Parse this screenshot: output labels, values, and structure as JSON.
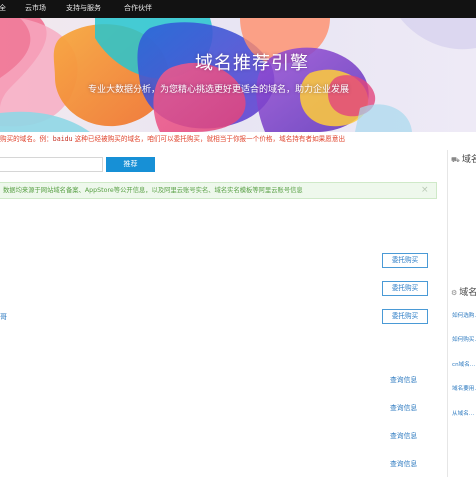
{
  "nav": {
    "items": [
      "全",
      "云市场",
      "支持与服务",
      "合作伙伴"
    ]
  },
  "hero": {
    "title": "域名推荐引擎",
    "subtitle": "专业大数据分析，为您精心挑选更好更适合的域名，助力企业发展"
  },
  "notice": {
    "part1": "购买的域名。例：",
    "example": "baidu",
    "part2": "   这种已经被购买的域名，咱们可以委托购买，就相当于你报一个价格，域名持有者如果愿意出"
  },
  "search": {
    "placeholder": "",
    "button_label": "推荐"
  },
  "alert": {
    "text": "数据均来源于网站域名备案、AppStore等公开信息，以及阿里云账号实名、域名实名模板等阿里云账号信息",
    "close_symbol": "×"
  },
  "row_fragment": "哥",
  "results": {
    "entrust_label": "委托购买",
    "query_label": "查询信息"
  },
  "sidebar": {
    "head1": "域名",
    "head2": "域名",
    "icon1": "cart-icon",
    "icon2": "gear-icon",
    "links": [
      "如何选购...",
      "如何购买...",
      "cn域名...",
      "域名要用...",
      "从域名..."
    ]
  },
  "colors": {
    "nav_bg": "#121212",
    "accent_blue": "#1790d6",
    "notice_red": "#e0442d",
    "alert_green": "#5aa046"
  }
}
